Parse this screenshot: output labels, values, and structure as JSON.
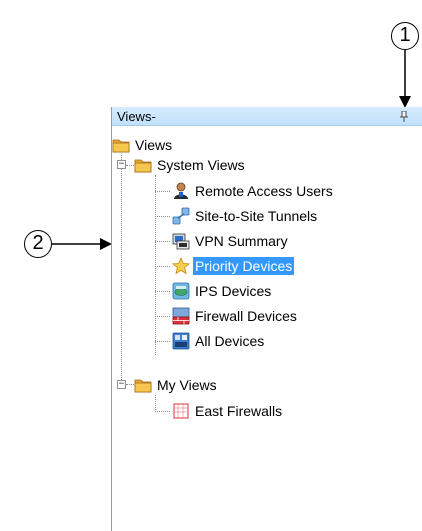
{
  "panel": {
    "title": "Views-"
  },
  "tree": {
    "root": "Views",
    "system_views": {
      "label": "System Views",
      "expander": "−",
      "items": [
        {
          "label": "Remote Access Users"
        },
        {
          "label": "Site-to-Site Tunnels"
        },
        {
          "label": "VPN Summary"
        },
        {
          "label": "Priority Devices",
          "selected": true
        },
        {
          "label": "IPS Devices"
        },
        {
          "label": "Firewall Devices"
        },
        {
          "label": "All Devices"
        }
      ]
    },
    "my_views": {
      "label": "My Views",
      "expander": "−",
      "items": [
        {
          "label": "East Firewalls"
        }
      ]
    }
  },
  "annotations": {
    "callout1": "1",
    "callout2": "2"
  },
  "colors": {
    "selection": "#3399ff",
    "titlebar": "#c9e4fb"
  }
}
